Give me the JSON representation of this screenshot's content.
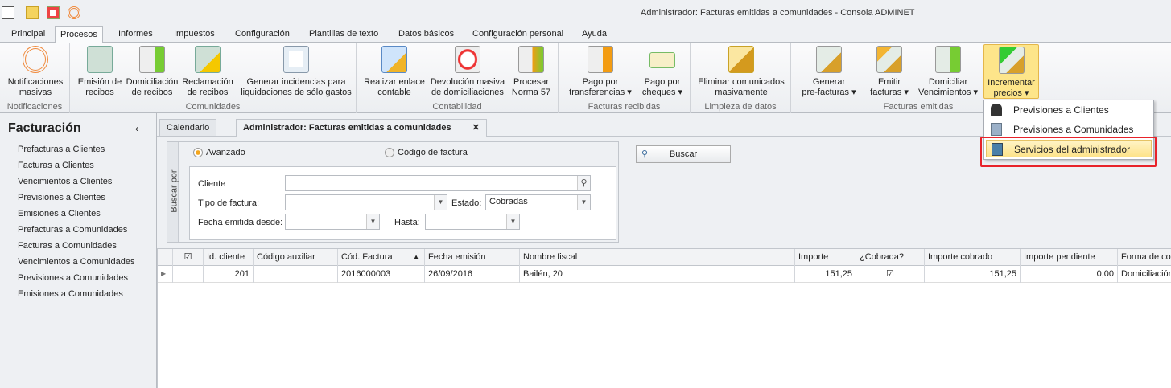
{
  "window": {
    "title": "Administrador: Facturas emitidas a comunidades - Consola ADMINET"
  },
  "menu_tabs": [
    "Principal",
    "Procesos",
    "Informes",
    "Impuestos",
    "Configuración",
    "Plantillas de texto",
    "Datos básicos",
    "Configuración personal",
    "Ayuda"
  ],
  "ribbon": {
    "groups": [
      "Notificaciones",
      "Comunidades",
      "Contabilidad",
      "Facturas recibidas",
      "Limpieza de datos",
      "Facturas emitidas"
    ],
    "buttons": [
      {
        "l1": "Notificaciones",
        "l2": "masivas"
      },
      {
        "l1": "Emisión de",
        "l2": "recibos"
      },
      {
        "l1": "Domiciliación",
        "l2": "de recibos"
      },
      {
        "l1": "Reclamación",
        "l2": "de recibos"
      },
      {
        "l1": "Generar incidencias para",
        "l2": "liquidaciones de sólo gastos"
      },
      {
        "l1": "Realizar enlace",
        "l2": "contable"
      },
      {
        "l1": "Devolución masiva",
        "l2": "de domiciliaciones"
      },
      {
        "l1": "Procesar",
        "l2": "Norma 57"
      },
      {
        "l1": "Pago por",
        "l2": "transferencias ▾"
      },
      {
        "l1": "Pago por",
        "l2": "cheques ▾"
      },
      {
        "l1": "Eliminar comunicados",
        "l2": "masivamente"
      },
      {
        "l1": "Generar",
        "l2": "pre-facturas ▾"
      },
      {
        "l1": "Emitir",
        "l2": "facturas ▾"
      },
      {
        "l1": "Domiciliar",
        "l2": "Vencimientos ▾"
      },
      {
        "l1": "Incrementar",
        "l2": "precios ▾"
      }
    ]
  },
  "dropdown": [
    "Previsiones a Clientes",
    "Previsiones a Comunidades",
    "Servicios del administrador"
  ],
  "sidebar": {
    "title": "Facturación",
    "items": [
      "Prefacturas a Clientes",
      "Facturas a Clientes",
      "Vencimientos a Clientes",
      "Previsiones a Clientes",
      "Emisiones a Clientes",
      "Prefacturas a Comunidades",
      "Facturas a Comunidades",
      "Vencimientos a Comunidades",
      "Previsiones a Comunidades",
      "Emisiones a Comunidades"
    ]
  },
  "doc_tabs": [
    "Calendario",
    "Administrador: Facturas emitidas a comunidades"
  ],
  "search": {
    "group_label": "Buscar por",
    "radio_advanced": "Avanzado",
    "radio_code": "Código de factura",
    "cliente_label": "Cliente",
    "cliente_value": "",
    "tipo_label": "Tipo de factura:",
    "tipo_value": "",
    "estado_label": "Estado:",
    "estado_value": "Cobradas",
    "desde_label": "Fecha emitida desde:",
    "desde_value": "",
    "hasta_label": "Hasta:",
    "hasta_value": "",
    "buscar_label": "Buscar"
  },
  "grid": {
    "columns": [
      "Id. cliente",
      "Código auxiliar",
      "Cód. Factura",
      "Fecha emisión",
      "Nombre fiscal",
      "Importe",
      "¿Cobrada?",
      "Importe cobrado",
      "Importe pendiente",
      "Forma de cobro"
    ],
    "rows": [
      {
        "id": "201",
        "aux": "",
        "code": "2016000003",
        "fecha": "26/09/2016",
        "nombre": "Bailén, 20",
        "importe": "151,25",
        "cobrada": true,
        "cobrado": "151,25",
        "pendiente": "0,00",
        "forma": "Domiciliación"
      }
    ]
  }
}
